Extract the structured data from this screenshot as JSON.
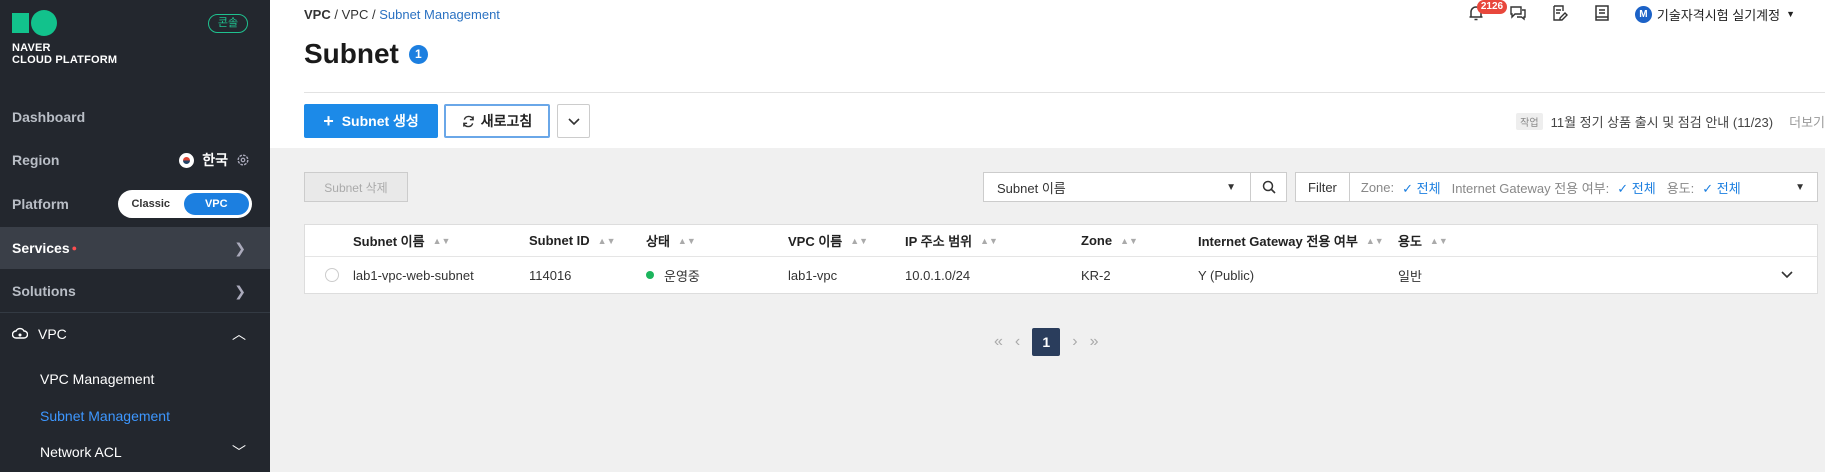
{
  "brand": {
    "line1": "NAVER",
    "line2": "CLOUD PLATFORM",
    "console_label": "콘솔"
  },
  "sidebar": {
    "dashboard": "Dashboard",
    "region_label": "Region",
    "region_value": "한국",
    "platform_label": "Platform",
    "platform_classic": "Classic",
    "platform_vpc": "VPC",
    "services": "Services",
    "solutions": "Solutions",
    "vpc": "VPC",
    "sub_items": [
      "VPC Management",
      "Subnet Management",
      "Network ACL"
    ]
  },
  "breadcrumb": {
    "root": "VPC",
    "parent": "VPC",
    "current": "Subnet Management",
    "sep": "/"
  },
  "header": {
    "notification_count": "2126",
    "user_initial": "M",
    "user_name": "기술자격시험 실기계정"
  },
  "page": {
    "title": "Subnet",
    "count": "1"
  },
  "toolbar": {
    "create_label": "Subnet 생성",
    "refresh_label": "새로고침"
  },
  "notice": {
    "tag": "작업",
    "text": "11월 정기 상품 출시 및 점검 안내 (11/23)",
    "more": "더보기"
  },
  "actions": {
    "delete_label": "Subnet 삭제"
  },
  "search": {
    "field": "Subnet 이름"
  },
  "filters": {
    "button": "Filter",
    "items": [
      {
        "label": "Zone:",
        "value": "전체"
      },
      {
        "label": "Internet Gateway 전용 여부:",
        "value": "전체"
      },
      {
        "label": "용도:",
        "value": "전체"
      }
    ]
  },
  "table": {
    "columns": [
      "Subnet 이름",
      "Subnet ID",
      "상태",
      "VPC 이름",
      "IP 주소 범위",
      "Zone",
      "Internet Gateway 전용 여부",
      "용도"
    ],
    "rows": [
      {
        "name": "lab1-vpc-web-subnet",
        "id": "114016",
        "status": "운영중",
        "vpc": "lab1-vpc",
        "ip": "10.0.1.0/24",
        "zone": "KR-2",
        "igw": "Y (Public)",
        "usage": "일반"
      }
    ]
  },
  "pagination": {
    "current": "1"
  },
  "colors": {
    "accent": "#1c8ae8",
    "sidebar_bg": "#23272e",
    "status_running": "#1cb55d",
    "brand_green": "#12c28c"
  }
}
